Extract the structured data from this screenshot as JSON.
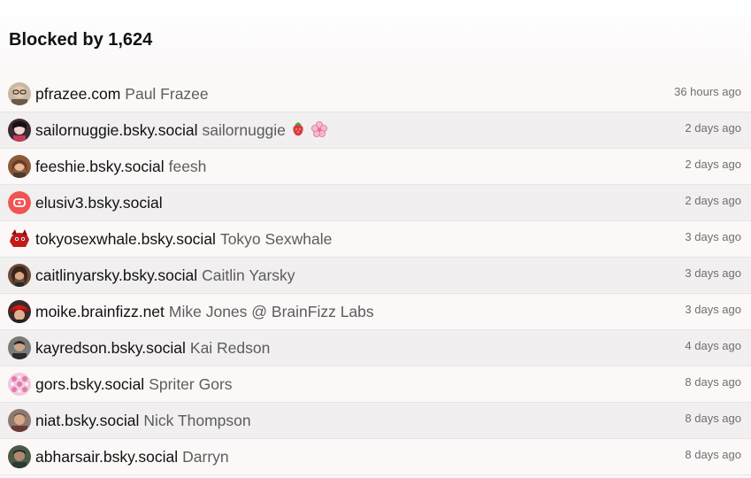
{
  "header": {
    "title": "Blocked by 1,624"
  },
  "rows": [
    {
      "handle": "pfrazee.com",
      "display_name": "Paul Frazee",
      "time": "36 hours ago",
      "avatar": "avatar-glasses"
    },
    {
      "handle": "sailornuggie.bsky.social",
      "display_name": "sailornuggie",
      "time": "2 days ago",
      "avatar": "avatar-photo",
      "emojis": [
        "strawberry-icon",
        "cherry-blossom-icon"
      ]
    },
    {
      "handle": "feeshie.bsky.social",
      "display_name": "feesh",
      "time": "2 days ago",
      "avatar": "avatar-photo"
    },
    {
      "handle": "elusiv3.bsky.social",
      "display_name": "",
      "time": "2 days ago",
      "avatar": "avatar-default"
    },
    {
      "handle": "tokyosexwhale.bsky.social",
      "display_name": "Tokyo Sexwhale",
      "time": "3 days ago",
      "avatar": "avatar-red-creature"
    },
    {
      "handle": "caitlinyarsky.bsky.social",
      "display_name": "Caitlin Yarsky",
      "time": "3 days ago",
      "avatar": "avatar-photo"
    },
    {
      "handle": "moike.brainfizz.net",
      "display_name": "Mike Jones @ BrainFizz Labs",
      "time": "3 days ago",
      "avatar": "avatar-red-hat"
    },
    {
      "handle": "kayredson.bsky.social",
      "display_name": "Kai Redson",
      "time": "4 days ago",
      "avatar": "avatar-photo"
    },
    {
      "handle": "gors.bsky.social",
      "display_name": "Spriter Gors",
      "time": "8 days ago",
      "avatar": "avatar-pink-pattern"
    },
    {
      "handle": "niat.bsky.social",
      "display_name": "Nick Thompson",
      "time": "8 days ago",
      "avatar": "avatar-photo"
    },
    {
      "handle": "abharsair.bsky.social",
      "display_name": "Darryn",
      "time": "8 days ago",
      "avatar": "avatar-photo"
    }
  ]
}
